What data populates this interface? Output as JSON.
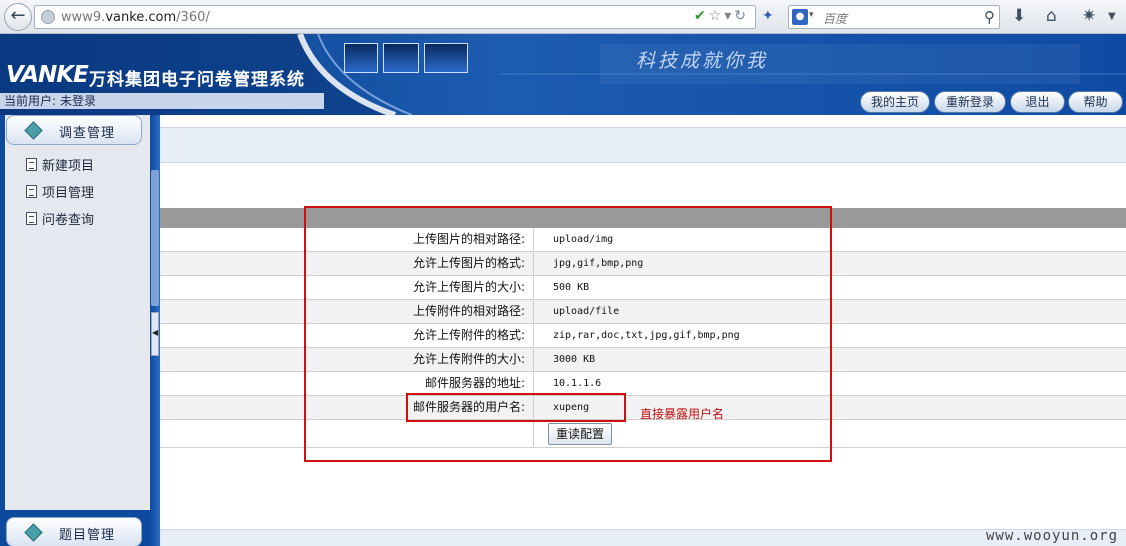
{
  "browser": {
    "url_prefix": "www9.",
    "url_domain": "vanke.com",
    "url_path": "/360/",
    "search_placeholder": "百度"
  },
  "header": {
    "logo": "VANKE",
    "system_title": "万科集团电子问卷管理系统",
    "slogan": "科技成就你我",
    "user_label": "当前用户:",
    "user_value": "未登录",
    "nav": {
      "home": "我的主页",
      "relogin": "重新登录",
      "logout": "退出",
      "help": "帮助"
    }
  },
  "sidebar": {
    "section1": "调查管理",
    "items": [
      "新建项目",
      "项目管理",
      "问卷查询"
    ],
    "section2": "题目管理"
  },
  "config": {
    "rows": [
      {
        "label": "上传图片的相对路径:",
        "value": "upload/img"
      },
      {
        "label": "允许上传图片的格式:",
        "value": "jpg,gif,bmp,png"
      },
      {
        "label": "允许上传图片的大小:",
        "value": "500 KB"
      },
      {
        "label": "上传附件的相对路径:",
        "value": "upload/file"
      },
      {
        "label": "允许上传附件的格式:",
        "value": "zip,rar,doc,txt,jpg,gif,bmp,png"
      },
      {
        "label": "允许上传附件的大小:",
        "value": "3000 KB"
      },
      {
        "label": "邮件服务器的地址:",
        "value": "10.1.1.6"
      },
      {
        "label": "邮件服务器的用户名:",
        "value": "xupeng"
      }
    ],
    "reload_button": "重读配置"
  },
  "annotation": {
    "note": "直接暴露用户名",
    "color": "#d01010"
  },
  "watermark": "www.wooyun.org"
}
